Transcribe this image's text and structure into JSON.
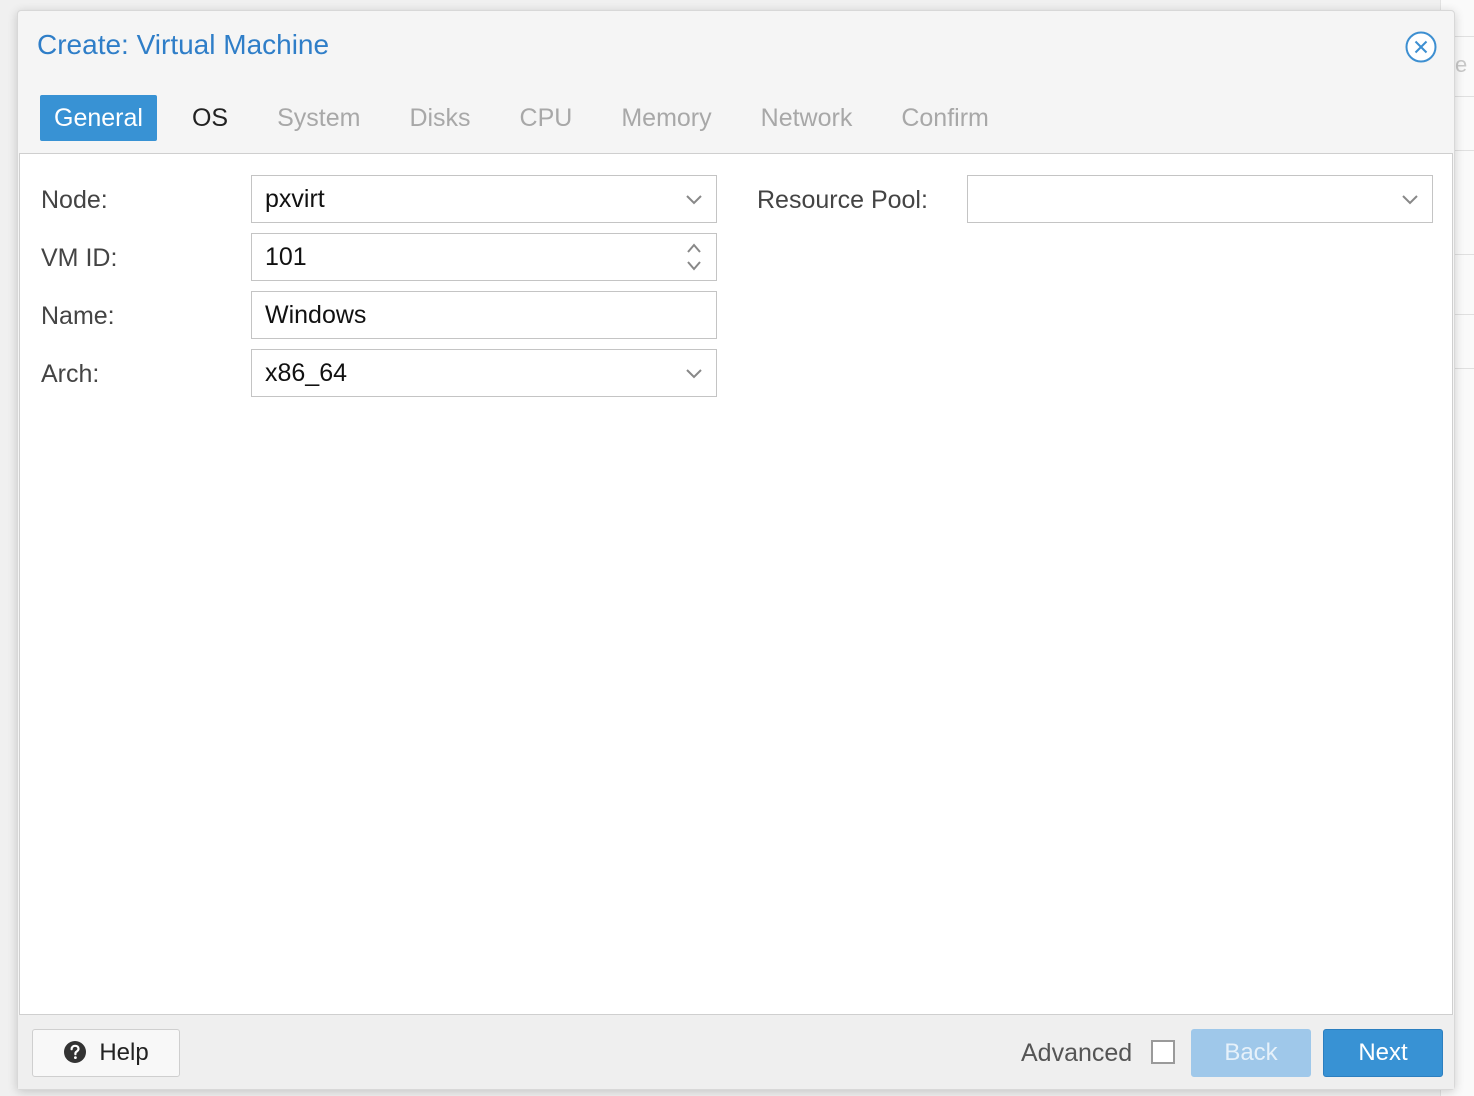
{
  "dialog": {
    "title": "Create: Virtual Machine"
  },
  "tabs": [
    {
      "label": "General",
      "state": "active"
    },
    {
      "label": "OS",
      "state": "enabled"
    },
    {
      "label": "System",
      "state": "disabled"
    },
    {
      "label": "Disks",
      "state": "disabled"
    },
    {
      "label": "CPU",
      "state": "disabled"
    },
    {
      "label": "Memory",
      "state": "disabled"
    },
    {
      "label": "Network",
      "state": "disabled"
    },
    {
      "label": "Confirm",
      "state": "disabled"
    }
  ],
  "form": {
    "node": {
      "label": "Node:",
      "value": "pxvirt"
    },
    "vmid": {
      "label": "VM ID:",
      "value": "101"
    },
    "name": {
      "label": "Name:",
      "value": "Windows"
    },
    "arch": {
      "label": "Arch:",
      "value": "x86_64"
    },
    "resource_pool": {
      "label": "Resource Pool:",
      "value": ""
    }
  },
  "footer": {
    "help_label": "Help",
    "advanced_label": "Advanced",
    "advanced_checked": false,
    "back_label": "Back",
    "next_label": "Next"
  },
  "background": {
    "partial_text": "e"
  },
  "colors": {
    "accent": "#3892d4",
    "title": "#2f7ec8",
    "disabled_tab_text": "#a8a8a8",
    "back_disabled": "#9fc8ea"
  },
  "icons": {
    "close": "close-circle-icon",
    "help": "question-circle-icon",
    "dropdown": "chevron-down-icon",
    "spinner": "spinner-up-down-icon"
  }
}
